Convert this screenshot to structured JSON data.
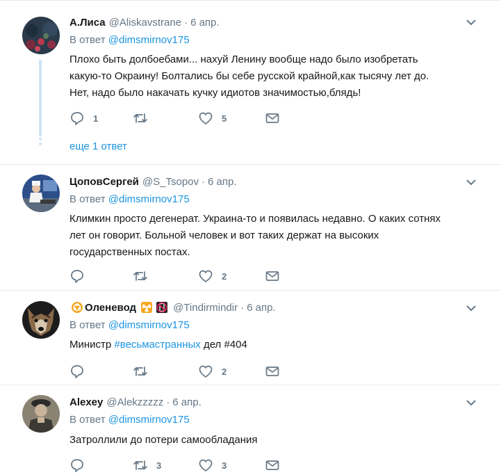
{
  "tweets": [
    {
      "name": "А.Лиса",
      "handle": "@Aliskavstrane",
      "dot": "·",
      "time": "6 апр.",
      "reply_prefix": "В ответ",
      "reply_to": "@dimsmirnov175",
      "lines": [
        "Плохо быть долбоебами... нахуй Ленину вообще надо было изобретать",
        "какую-то Окраину! Болтались бы себе русской крайной,как тысячу лет до.",
        "Нет, надо было накачать кучку идиотов значимостью,блядь!"
      ],
      "replies": "1",
      "retweets": "",
      "likes": "5",
      "more_replies": "еще 1 ответ"
    },
    {
      "name": "ЦоповСергей",
      "handle": "@S_Tsopov",
      "dot": "·",
      "time": "6 апр.",
      "reply_prefix": "В ответ",
      "reply_to": "@dimsmirnov175",
      "lines": [
        "Климкин просто дегенерат. Украина-то и появилась недавно. О каких сотнях",
        "лет он говорит. Больной человек и вот таких держат на высоких",
        "государственных постах."
      ],
      "replies": "",
      "retweets": "",
      "likes": "2"
    },
    {
      "name": "Оленевод",
      "handle": "@Tindirmindir",
      "dot": "·",
      "time": "6 апр.",
      "reply_prefix": "В ответ",
      "reply_to": "@dimsmirnov175",
      "text_prefix": "Министр",
      "hashtag": "#весьмастранных",
      "text_suffix": "дел #404",
      "replies": "",
      "retweets": "",
      "likes": "2",
      "icons": [
        "biohazard-emoji-icon",
        "radioactive-emoji-icon",
        "no-mobile-phones-emoji-icon"
      ]
    },
    {
      "name": "Alexey",
      "handle": "@Alekzzzzz",
      "dot": "·",
      "time": "6 апр.",
      "reply_prefix": "В ответ",
      "reply_to": "@dimsmirnov175",
      "lines": [
        "Затроллили до потери самообладания"
      ],
      "replies": "",
      "retweets": "3",
      "likes": "3"
    }
  ],
  "colors": {
    "link": "#1b95e0",
    "secondary": "#657786",
    "text": "#14171a",
    "divider": "#e6ecf0",
    "thread": "#cce4f7"
  },
  "icons": {
    "reply": "reply-icon",
    "retweet": "retweet-icon",
    "like": "heart-icon",
    "dm": "envelope-icon",
    "menu": "chevron-down-icon"
  }
}
